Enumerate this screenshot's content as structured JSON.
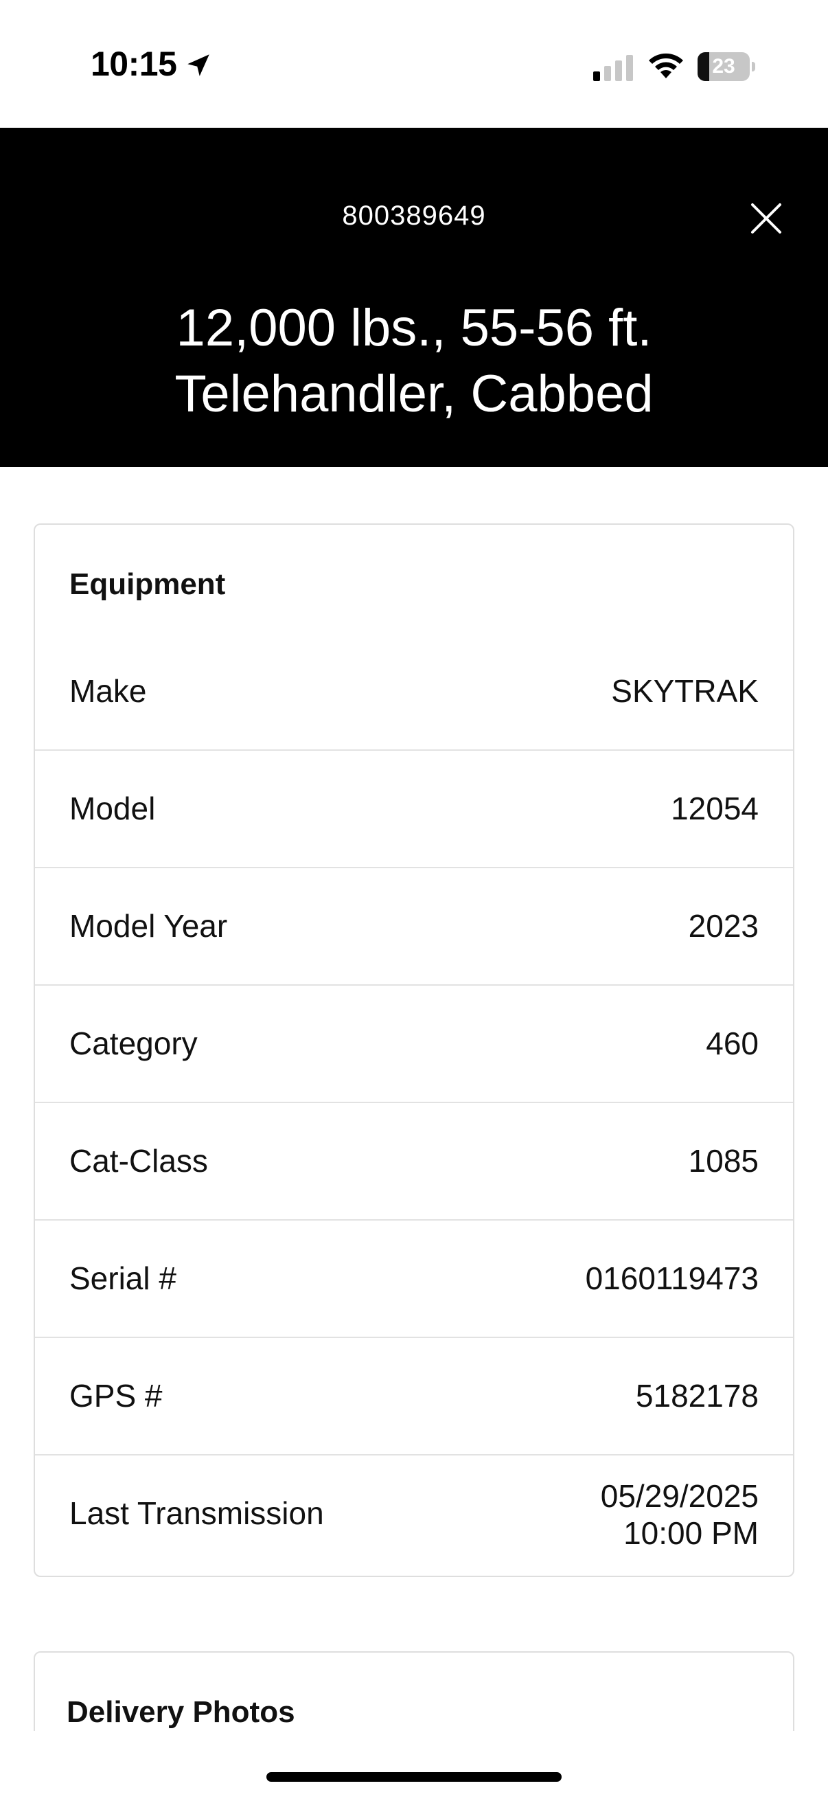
{
  "status_bar": {
    "time": "10:15",
    "battery_level": "23",
    "battery_fraction": 0.23,
    "icons": [
      "location-arrow-icon",
      "cellular-signal-icon",
      "wifi-icon",
      "battery-icon"
    ]
  },
  "header": {
    "asset_number": "800389649",
    "title_line1": "12,000 lbs., 55-56 ft.",
    "title_line2": "Telehandler, Cabbed",
    "close_icon": "close-icon",
    "background": "#000000",
    "text_color": "#ffffff"
  },
  "equipment": {
    "heading": "Equipment",
    "rows": [
      {
        "label": "Make",
        "value": "SKYTRAK"
      },
      {
        "label": "Model",
        "value": "12054"
      },
      {
        "label": "Model Year",
        "value": "2023"
      },
      {
        "label": "Category",
        "value": "460"
      },
      {
        "label": "Cat-Class",
        "value": "1085"
      },
      {
        "label": "Serial #",
        "value": "0160119473"
      },
      {
        "label": "GPS #",
        "value": "5182178"
      },
      {
        "label": "Last Transmission",
        "value_date": "05/29/2025",
        "value_time": "10:00 PM"
      }
    ]
  },
  "delivery_photos": {
    "heading": "Delivery Photos"
  }
}
